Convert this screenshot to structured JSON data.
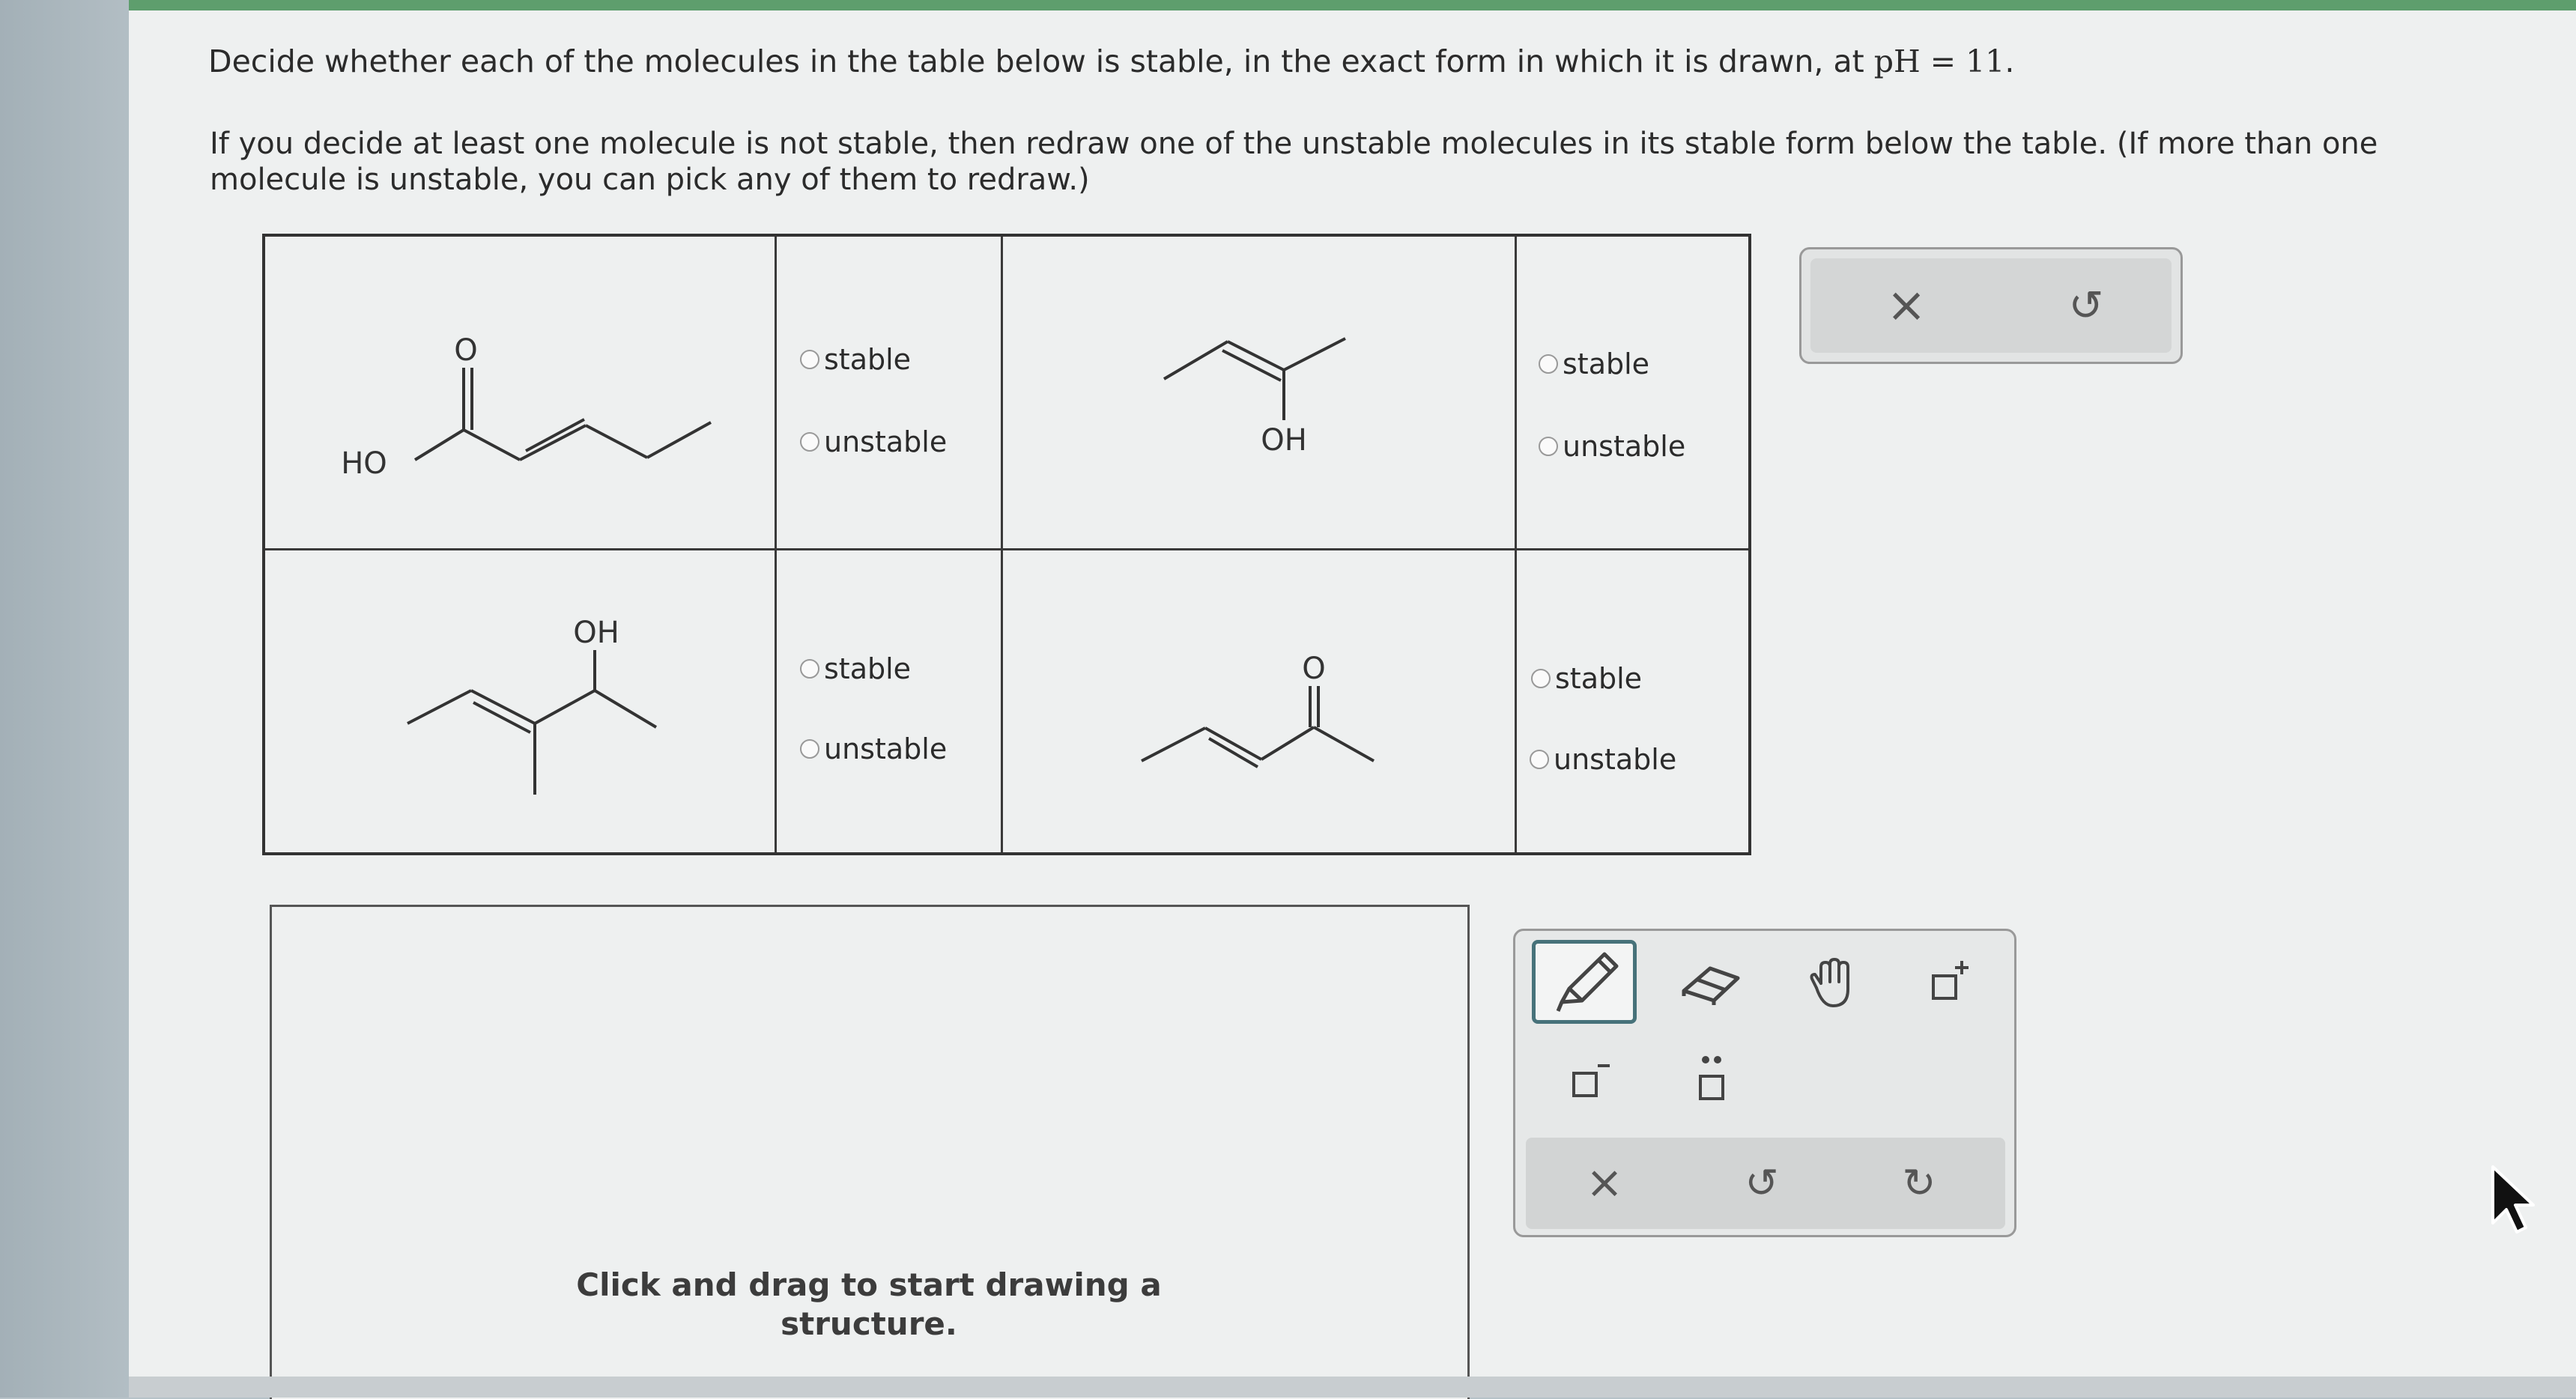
{
  "question": {
    "line1_prefix": "Decide whether each of the molecules in the table below is stable, in the exact form in which it is drawn, at ",
    "line1_ph": "pH = 11",
    "line1_suffix": ".",
    "line2": "If you decide at least one molecule is not stable, then redraw one of the unstable molecules in its stable form below the table. (If more than one molecule is unstable, you can pick any of them to redraw.)"
  },
  "table": {
    "molecules": [
      {
        "labels": [
          "O",
          "HO"
        ]
      },
      {
        "labels": [
          "OH"
        ]
      },
      {
        "labels": [
          "OH"
        ]
      },
      {
        "labels": [
          "O"
        ]
      }
    ],
    "options": {
      "stable": "stable",
      "unstable": "unstable"
    }
  },
  "drawing": {
    "hint_line1": "Click and drag to start drawing a",
    "hint_line2": "structure."
  },
  "icons": {
    "close": "×",
    "undo": "↺",
    "redo": "↻"
  },
  "colors": {
    "accent": "#47727a",
    "topbar": "#5e9e6d"
  }
}
